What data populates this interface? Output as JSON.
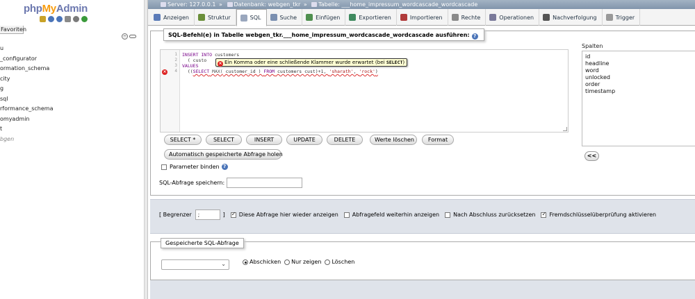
{
  "nav": {
    "logo": {
      "php": "php",
      "my": "My",
      "admin": "Admin"
    },
    "favorites_tab": "Favoriten",
    "databases": [
      "u",
      "_configurator",
      "ormation_schema",
      "city",
      "g",
      "sql",
      "rformance_schema",
      "omyadmin",
      "t",
      "bgen"
    ]
  },
  "breadcrumb": {
    "server": "Server: 127.0.0.1",
    "database": "Datenbank: webgen_tkr",
    "table": "Tabelle: ___home_impressum_wordcascade_wordcascade",
    "separator": "»"
  },
  "tabs": [
    {
      "label": "Anzeigen",
      "icon": "browse-icon",
      "color": "#5b7bb8"
    },
    {
      "label": "Struktur",
      "icon": "structure-icon",
      "color": "#6a8f3a"
    },
    {
      "label": "SQL",
      "icon": "sql-icon",
      "color": "#9aa7bd",
      "active": true
    },
    {
      "label": "Suche",
      "icon": "search-icon",
      "color": "#7a8fb0"
    },
    {
      "label": "Einfügen",
      "icon": "insert-icon",
      "color": "#4f8f4f"
    },
    {
      "label": "Exportieren",
      "icon": "export-icon",
      "color": "#3f8a5f"
    },
    {
      "label": "Importieren",
      "icon": "import-icon",
      "color": "#b03a3a"
    },
    {
      "label": "Rechte",
      "icon": "privileges-icon",
      "color": "#8a8a8a"
    },
    {
      "label": "Operationen",
      "icon": "operations-icon",
      "color": "#7a7a9a"
    },
    {
      "label": "Nachverfolgung",
      "icon": "tracking-icon",
      "color": "#555555"
    },
    {
      "label": "Trigger",
      "icon": "trigger-icon",
      "color": "#999999"
    }
  ],
  "sql_box": {
    "legend": "SQL-Befehl(e) in Tabelle webgen_tkr.___home_impressum_wordcascade_wordcascade ausführen:",
    "line_numbers": [
      "1",
      "2",
      "3",
      "4"
    ],
    "code": {
      "line1_kw": "INSERT INTO",
      "line1_rest": " customers",
      "line2": "  ( custo",
      "line3_kw": "VALUES",
      "line4_a": "  ((",
      "line4_kw": "SELECT",
      "line4_fn": " MAX(",
      "line4_b": " customer_id ) ",
      "line4_kw2": "FROM",
      "line4_c": " customers cust)+1, ",
      "line4_s1": "'sharath'",
      "line4_d": ", ",
      "line4_s2": "'rock'",
      "line4_e": ")"
    },
    "error_tooltip": {
      "text": "Ein Komma oder eine schließende Klammer wurde erwartet (bei",
      "token": "SELECT",
      "close": ")"
    },
    "buttons": [
      "SELECT *",
      "SELECT",
      "INSERT",
      "UPDATE",
      "DELETE",
      "Werte löschen",
      "Format"
    ],
    "autoload_button": "Automatisch gespeicherte Abfrage holen",
    "param_label": "Parameter binden",
    "save_label": "SQL-Abfrage speichern:",
    "save_value": ""
  },
  "columns_panel": {
    "label": "Spalten",
    "items": [
      "id",
      "headline",
      "word",
      "unlocked",
      "order",
      "timestamp"
    ],
    "insert_button": "<<"
  },
  "options": {
    "begrenzer_open": "[ Begrenzer",
    "begrenzer_value": ";",
    "begrenzer_close": "]",
    "show_again": {
      "label": "Diese Abfrage hier wieder anzeigen",
      "checked": true
    },
    "keep_box": {
      "label": "Abfragefeld weiterhin anzeigen",
      "checked": false
    },
    "rollback": {
      "label": "Nach Abschluss zurücksetzen",
      "checked": false
    },
    "fk_check": {
      "label": "Fremdschlüsselüberprüfung aktivieren",
      "checked": true
    }
  },
  "saved_query": {
    "legend": "Gespeicherte SQL-Abfrage",
    "selected": "",
    "radios": [
      {
        "label": "Abschicken",
        "checked": true
      },
      {
        "label": "Nur zeigen",
        "checked": false
      },
      {
        "label": "Löschen",
        "checked": false
      }
    ]
  }
}
